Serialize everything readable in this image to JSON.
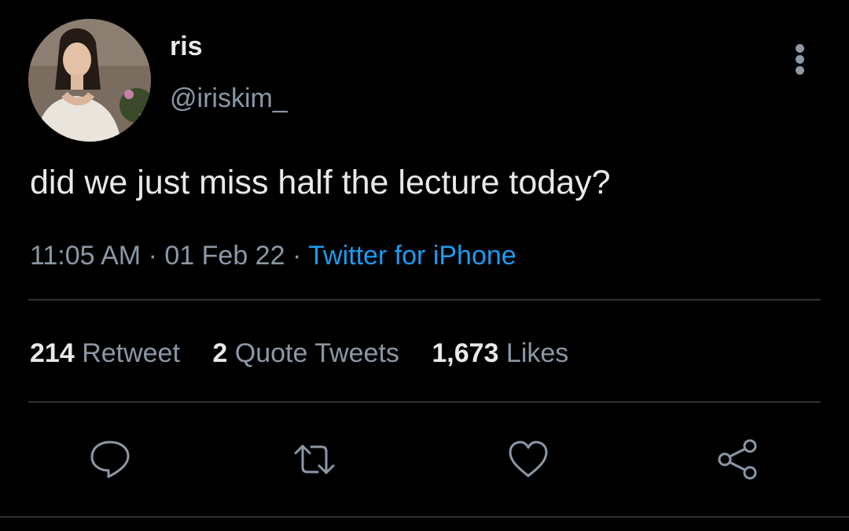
{
  "user": {
    "display_name": "ris",
    "handle": "@iriskim_",
    "avatar_icon": "profile-photo"
  },
  "tweet": {
    "text": "did we just miss half the lecture today?",
    "time": "11:05 AM",
    "separator": "·",
    "date": "01 Feb 22",
    "source": "Twitter for iPhone"
  },
  "stats": {
    "retweets": {
      "count": "214",
      "label": "Retweet"
    },
    "quotes": {
      "count": "2",
      "label": "Quote Tweets"
    },
    "likes": {
      "count": "1,673",
      "label": "Likes"
    }
  },
  "actions": {
    "icons": [
      "reply-icon",
      "retweet-icon",
      "like-icon",
      "share-icon"
    ]
  },
  "colors": {
    "background": "#000000",
    "text_primary": "#e7e9ea",
    "text_secondary": "#8b98a5",
    "link": "#1d9bf0",
    "divider": "#2f3336"
  }
}
